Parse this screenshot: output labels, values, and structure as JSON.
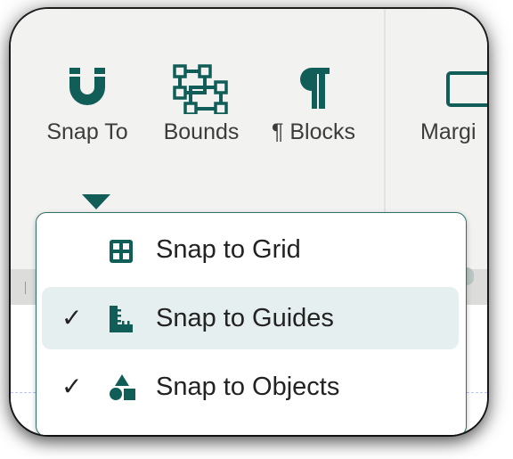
{
  "toolbar": {
    "tools": [
      {
        "label": "Snap To",
        "icon": "magnet-icon"
      },
      {
        "label": "Bounds",
        "icon": "bounds-icon"
      },
      {
        "label": "¶ Blocks",
        "icon": "pilcrow-icon"
      },
      {
        "label": "Margi",
        "icon": "margins-icon"
      }
    ]
  },
  "snap_menu": {
    "items": [
      {
        "label": "Snap to Grid",
        "icon": "grid-icon",
        "checked": false,
        "highlighted": false
      },
      {
        "label": "Snap to Guides",
        "icon": "ruler-icon",
        "checked": true,
        "highlighted": true
      },
      {
        "label": "Snap to Objects",
        "icon": "shapes-icon",
        "checked": true,
        "highlighted": false
      }
    ],
    "check_glyph": "✓"
  },
  "colors": {
    "accent": "#115e59",
    "menu_highlight": "#e6eff0",
    "toolbar_bg": "#f2f2f1"
  }
}
